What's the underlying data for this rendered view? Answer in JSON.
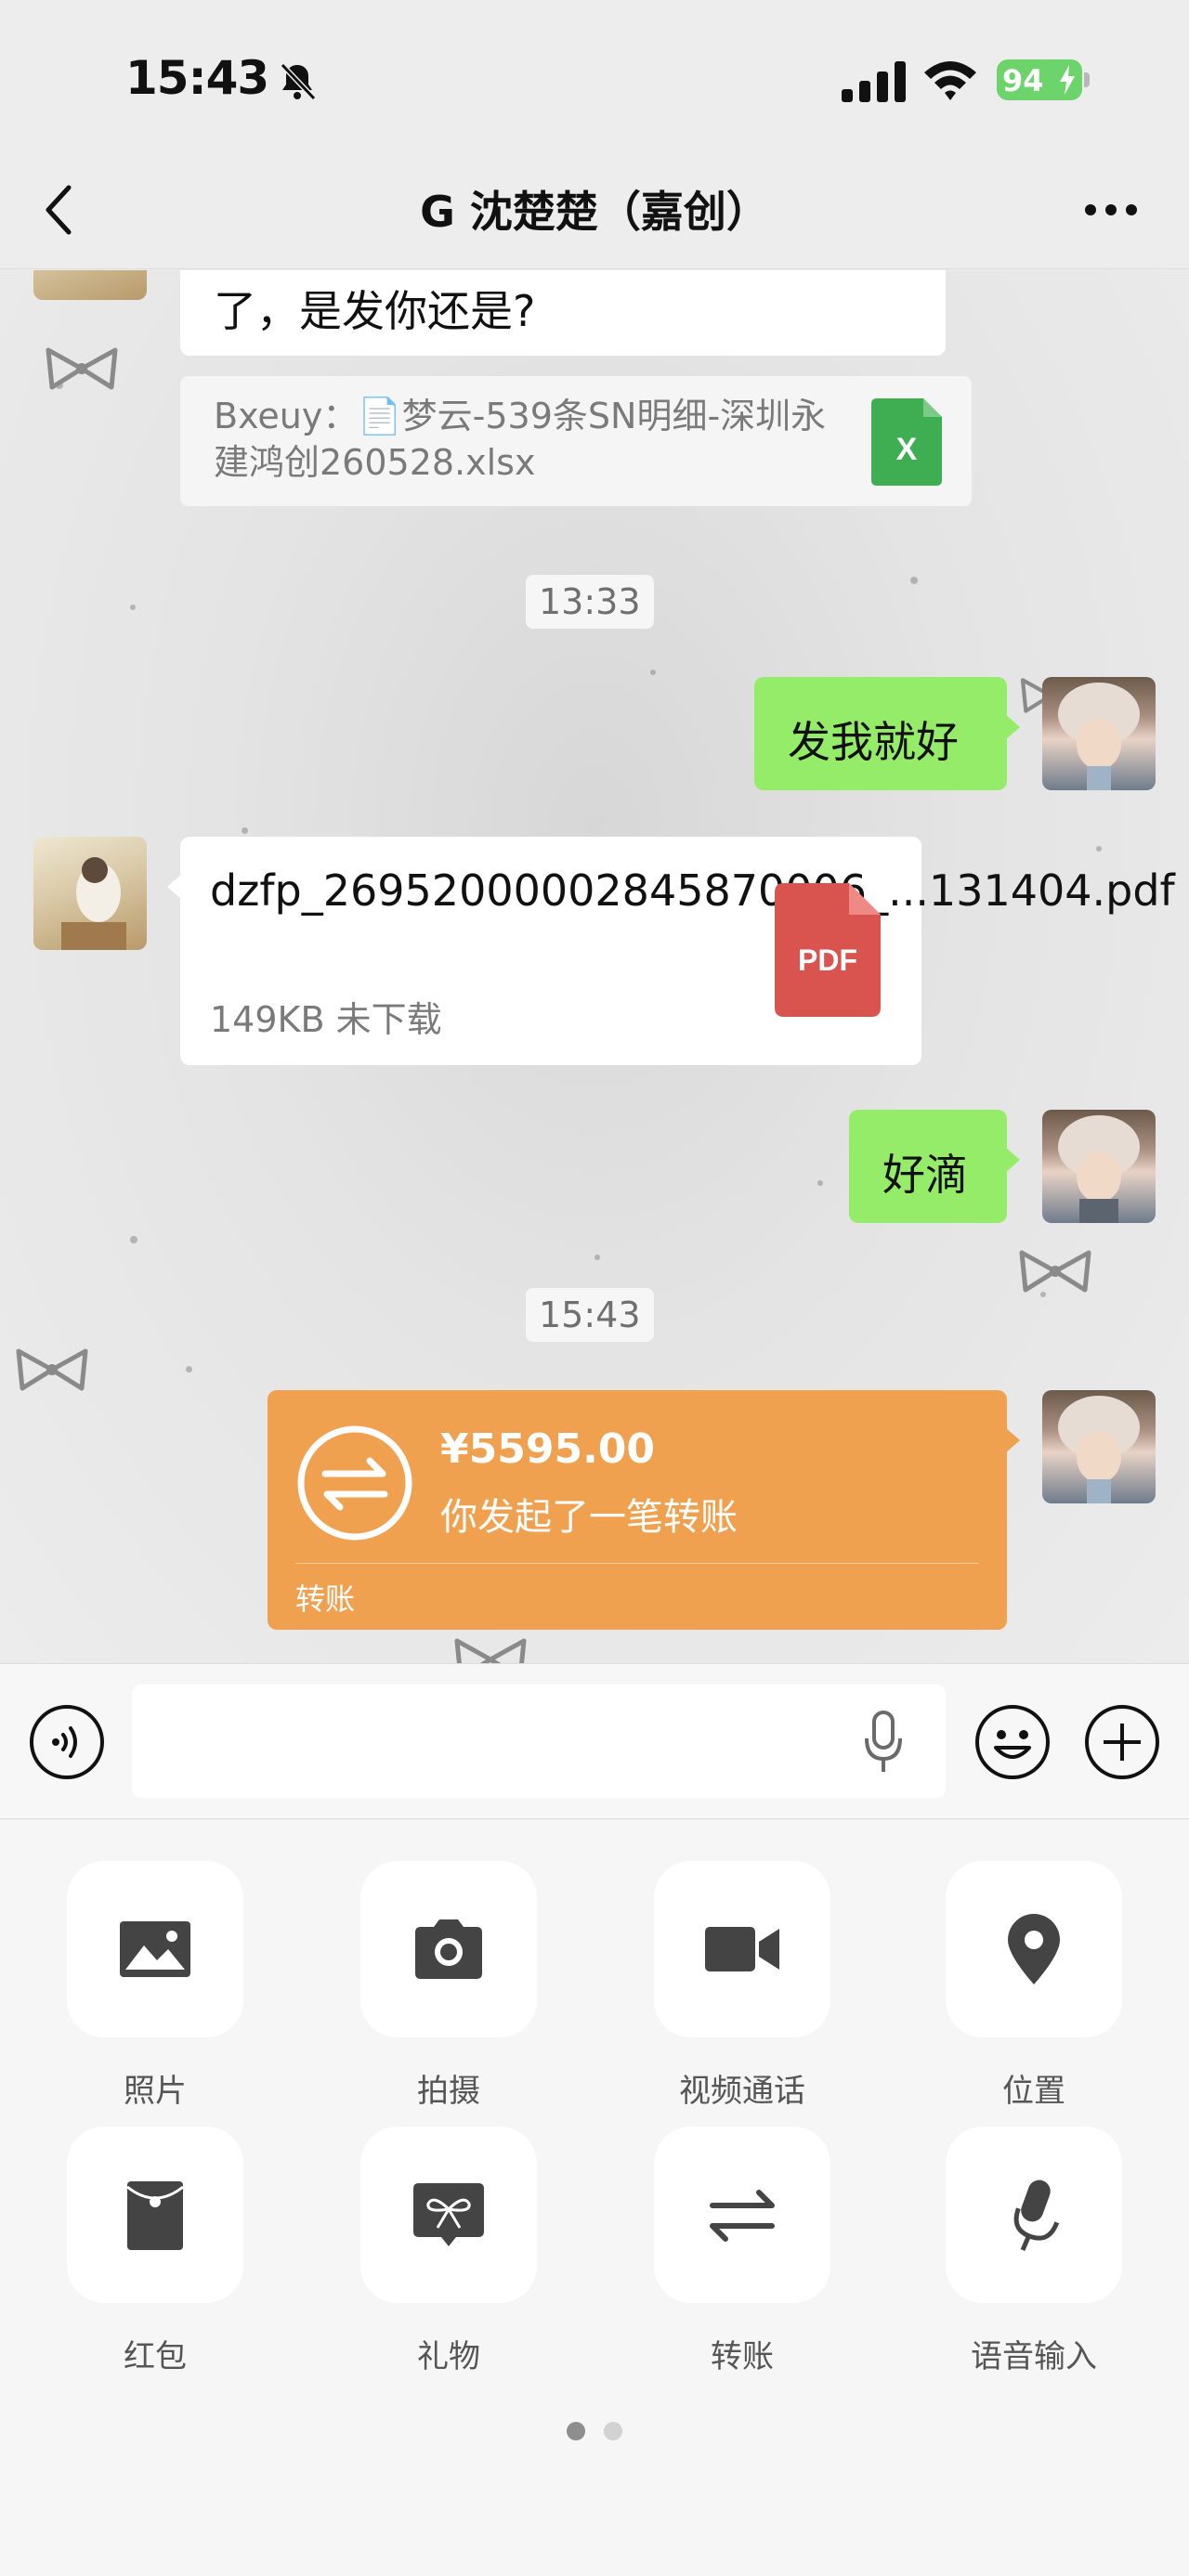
{
  "status_bar": {
    "time": "15:43",
    "battery": "94"
  },
  "nav": {
    "title": "G 沈楚楚（嘉创）"
  },
  "messages": {
    "partial_text": "了，是发你还是?",
    "quote": "Bxeuy：📄梦云-539条SN明细-深圳永建鸿创260528.xlsx",
    "xlsx_icon_label": "X",
    "time1": "13:33",
    "reply1": "发我就好",
    "pdf_name": "dzfp_26952000002845870006_...131404.pdf",
    "pdf_meta": "149KB  未下载",
    "pdf_icon_label": "PDF",
    "reply2": "好滴",
    "time2": "15:43",
    "transfer_amount": "¥5595.00",
    "transfer_desc": "你发起了一笔转账",
    "transfer_label": "转账"
  },
  "input": {
    "value": "",
    "placeholder": ""
  },
  "panel": {
    "items": [
      {
        "label": "照片",
        "icon": "photo-icon"
      },
      {
        "label": "拍摄",
        "icon": "camera-icon"
      },
      {
        "label": "视频通话",
        "icon": "video-call-icon"
      },
      {
        "label": "位置",
        "icon": "location-icon"
      },
      {
        "label": "红包",
        "icon": "red-packet-icon"
      },
      {
        "label": "礼物",
        "icon": "gift-icon"
      },
      {
        "label": "转账",
        "icon": "transfer-icon"
      },
      {
        "label": "语音输入",
        "icon": "voice-input-icon"
      }
    ],
    "page_count": 2,
    "current_page": 1
  },
  "colors": {
    "bubble_green": "#95ec69",
    "transfer_orange": "#f0a150",
    "battery_green": "#6cd46b",
    "xlsx_green": "#3fae52",
    "pdf_red": "#d9534f"
  }
}
